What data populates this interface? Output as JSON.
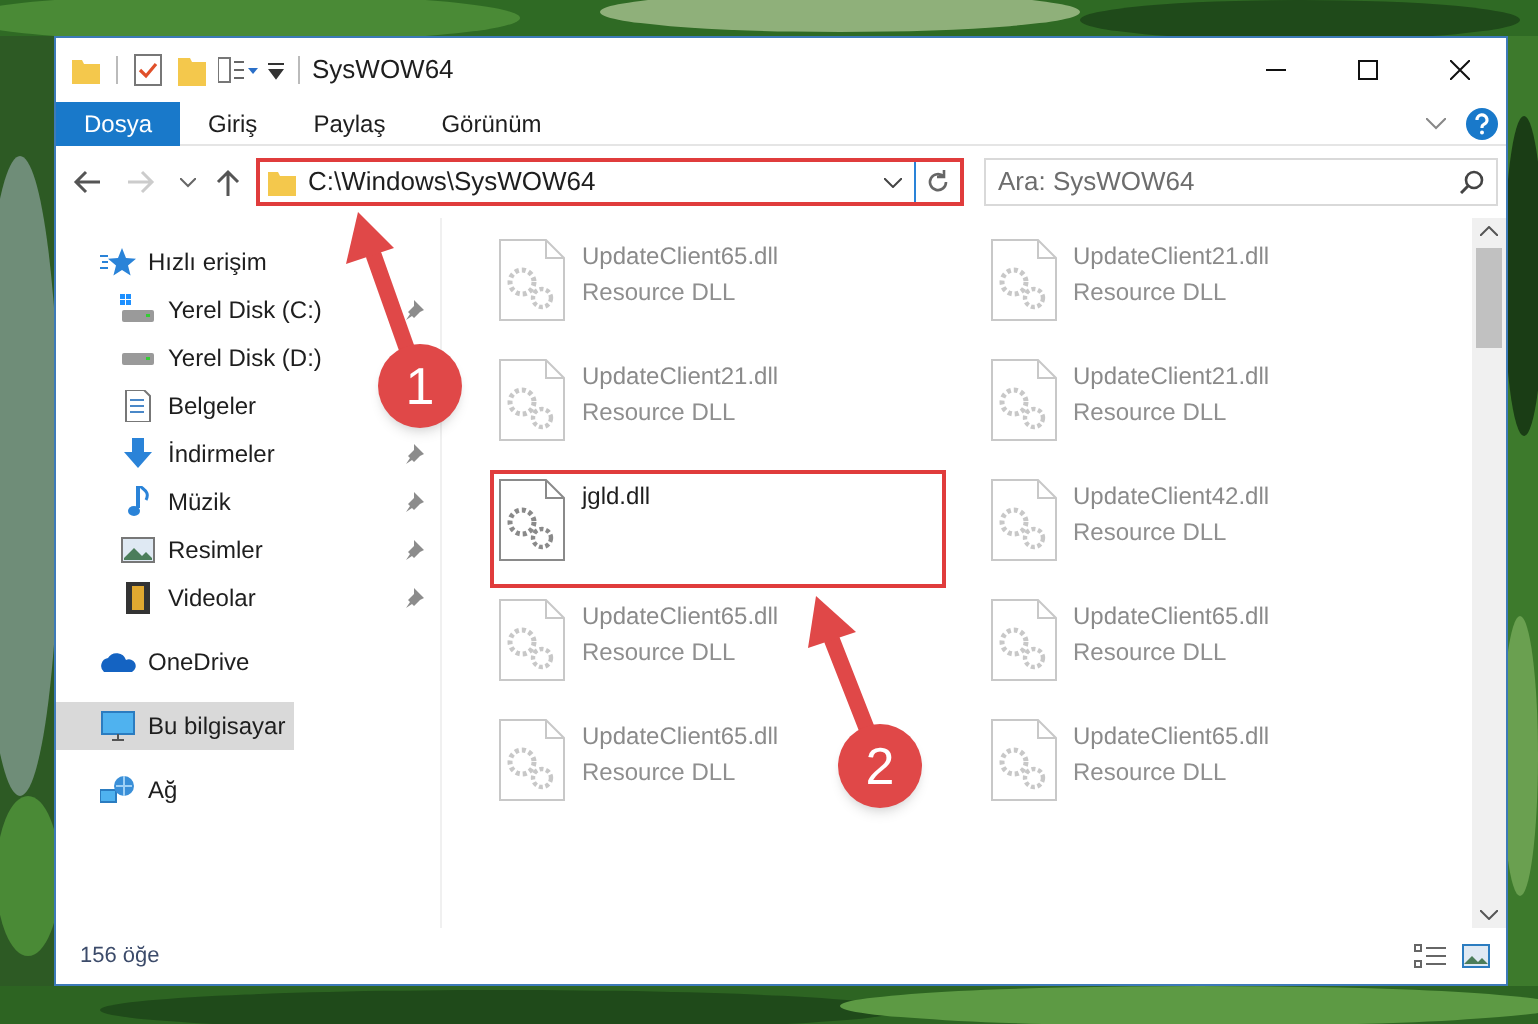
{
  "window": {
    "title": "SysWOW64"
  },
  "ribbon_tabs": [
    {
      "label": "Dosya",
      "selected": true
    },
    {
      "label": "Giriş",
      "selected": false
    },
    {
      "label": "Paylaş",
      "selected": false
    },
    {
      "label": "Görünüm",
      "selected": false
    }
  ],
  "address": {
    "path": "C:\\Windows\\SysWOW64",
    "highlighted": true
  },
  "search": {
    "placeholder": "Ara: SysWOW64"
  },
  "sidebar": {
    "items": [
      {
        "label": "Hızlı erişim",
        "kind": "quick-access",
        "selected": false,
        "children": [
          {
            "label": "Yerel Disk (C:)",
            "kind": "system-drive",
            "selected": false,
            "pinned": true
          },
          {
            "label": "Yerel Disk (D:)",
            "kind": "drive",
            "selected": false
          },
          {
            "label": "Belgeler",
            "kind": "documents",
            "selected": false
          },
          {
            "label": "İndirmeler",
            "kind": "downloads",
            "selected": false,
            "pinned": true
          },
          {
            "label": "Müzik",
            "kind": "music",
            "selected": false,
            "pinned": true
          },
          {
            "label": "Resimler",
            "kind": "pictures",
            "selected": false,
            "pinned": true
          },
          {
            "label": "Videolar",
            "kind": "videos",
            "selected": false,
            "pinned": true
          }
        ]
      },
      {
        "label": "OneDrive",
        "kind": "cloud",
        "selected": false
      },
      {
        "label": "Bu bilgisayar",
        "kind": "computer",
        "selected": true
      },
      {
        "label": "Ağ",
        "kind": "network",
        "selected": false
      }
    ]
  },
  "files": [
    {
      "name": "UpdateClient65.dll",
      "type": "Resource DLL",
      "blurred": true,
      "highlighted": false
    },
    {
      "name": "UpdateClient21.dll",
      "type": "Resource DLL",
      "blurred": true,
      "highlighted": false
    },
    {
      "name": "UpdateClient21.dll",
      "type": "Resource DLL",
      "blurred": true,
      "highlighted": false
    },
    {
      "name": "UpdateClient21.dll",
      "type": "Resource DLL",
      "blurred": true,
      "highlighted": false
    },
    {
      "name": "jgld.dll",
      "blurred": false,
      "highlighted": true
    },
    {
      "name": "UpdateClient42.dll",
      "type": "Resource DLL",
      "blurred": true,
      "highlighted": false
    },
    {
      "name": "UpdateClient65.dll",
      "type": "Resource DLL",
      "blurred": true,
      "highlighted": false
    },
    {
      "name": "UpdateClient65.dll",
      "type": "Resource DLL",
      "blurred": true,
      "highlighted": false
    },
    {
      "name": "UpdateClient65.dll",
      "type": "Resource DLL",
      "blurred": true,
      "highlighted": false
    },
    {
      "name": "UpdateClient65.dll",
      "type": "Resource DLL",
      "blurred": true,
      "highlighted": false
    }
  ],
  "callouts": [
    {
      "number": "1"
    },
    {
      "number": "2"
    }
  ],
  "status_bar": {
    "count": "156 öğe"
  }
}
